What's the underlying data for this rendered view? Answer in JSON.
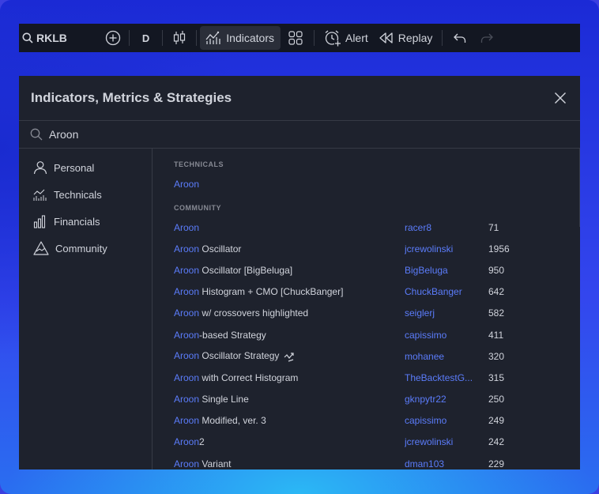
{
  "toolbar": {
    "symbol": "RKLB",
    "interval": "D",
    "indicators_label": "Indicators",
    "alert_label": "Alert",
    "replay_label": "Replay"
  },
  "dialog": {
    "title": "Indicators, Metrics & Strategies",
    "search_value": "Aroon"
  },
  "sidebar": {
    "items": [
      {
        "label": "Personal",
        "icon": "person-icon"
      },
      {
        "label": "Technicals",
        "icon": "technicals-icon"
      },
      {
        "label": "Financials",
        "icon": "financials-icon"
      },
      {
        "label": "Community",
        "icon": "community-icon"
      }
    ]
  },
  "technicals": {
    "header": "Technicals",
    "items": [
      {
        "highlight": "Aroon",
        "rest": ""
      }
    ]
  },
  "community": {
    "header": "Community",
    "items": [
      {
        "highlight": "Aroon",
        "rest": "",
        "author": "racer8",
        "count": "71"
      },
      {
        "highlight": "Aroon",
        "rest": " Oscillator",
        "author": "jcrewolinski",
        "count": "1956"
      },
      {
        "highlight": "Aroon",
        "rest": " Oscillator [BigBeluga]",
        "author": "BigBeluga",
        "count": "950"
      },
      {
        "highlight": "Aroon",
        "rest": " Histogram + CMO [ChuckBanger]",
        "author": "ChuckBanger",
        "count": "642"
      },
      {
        "highlight": "Aroon",
        "rest": " w/ crossovers highlighted",
        "author": "seiglerj",
        "count": "582"
      },
      {
        "highlight": "Aroon",
        "rest": "-based Strategy",
        "author": "capissimo",
        "count": "411"
      },
      {
        "highlight": "Aroon",
        "rest": " Oscillator Strategy",
        "author": "mohanee",
        "count": "320",
        "strategy": true
      },
      {
        "highlight": "Aroon",
        "rest": " with Correct Histogram",
        "author": "TheBacktestG...",
        "count": "315"
      },
      {
        "highlight": "Aroon",
        "rest": " Single Line",
        "author": "gknpytr22",
        "count": "250"
      },
      {
        "highlight": "Aroon",
        "rest": " Modified, ver. 3",
        "author": "capissimo",
        "count": "249"
      },
      {
        "highlight": "Aroon",
        "rest": "2",
        "author": "jcrewolinski",
        "count": "242"
      },
      {
        "highlight": "Aroon",
        "rest": " Variant",
        "author": "dman103",
        "count": "229"
      }
    ]
  }
}
